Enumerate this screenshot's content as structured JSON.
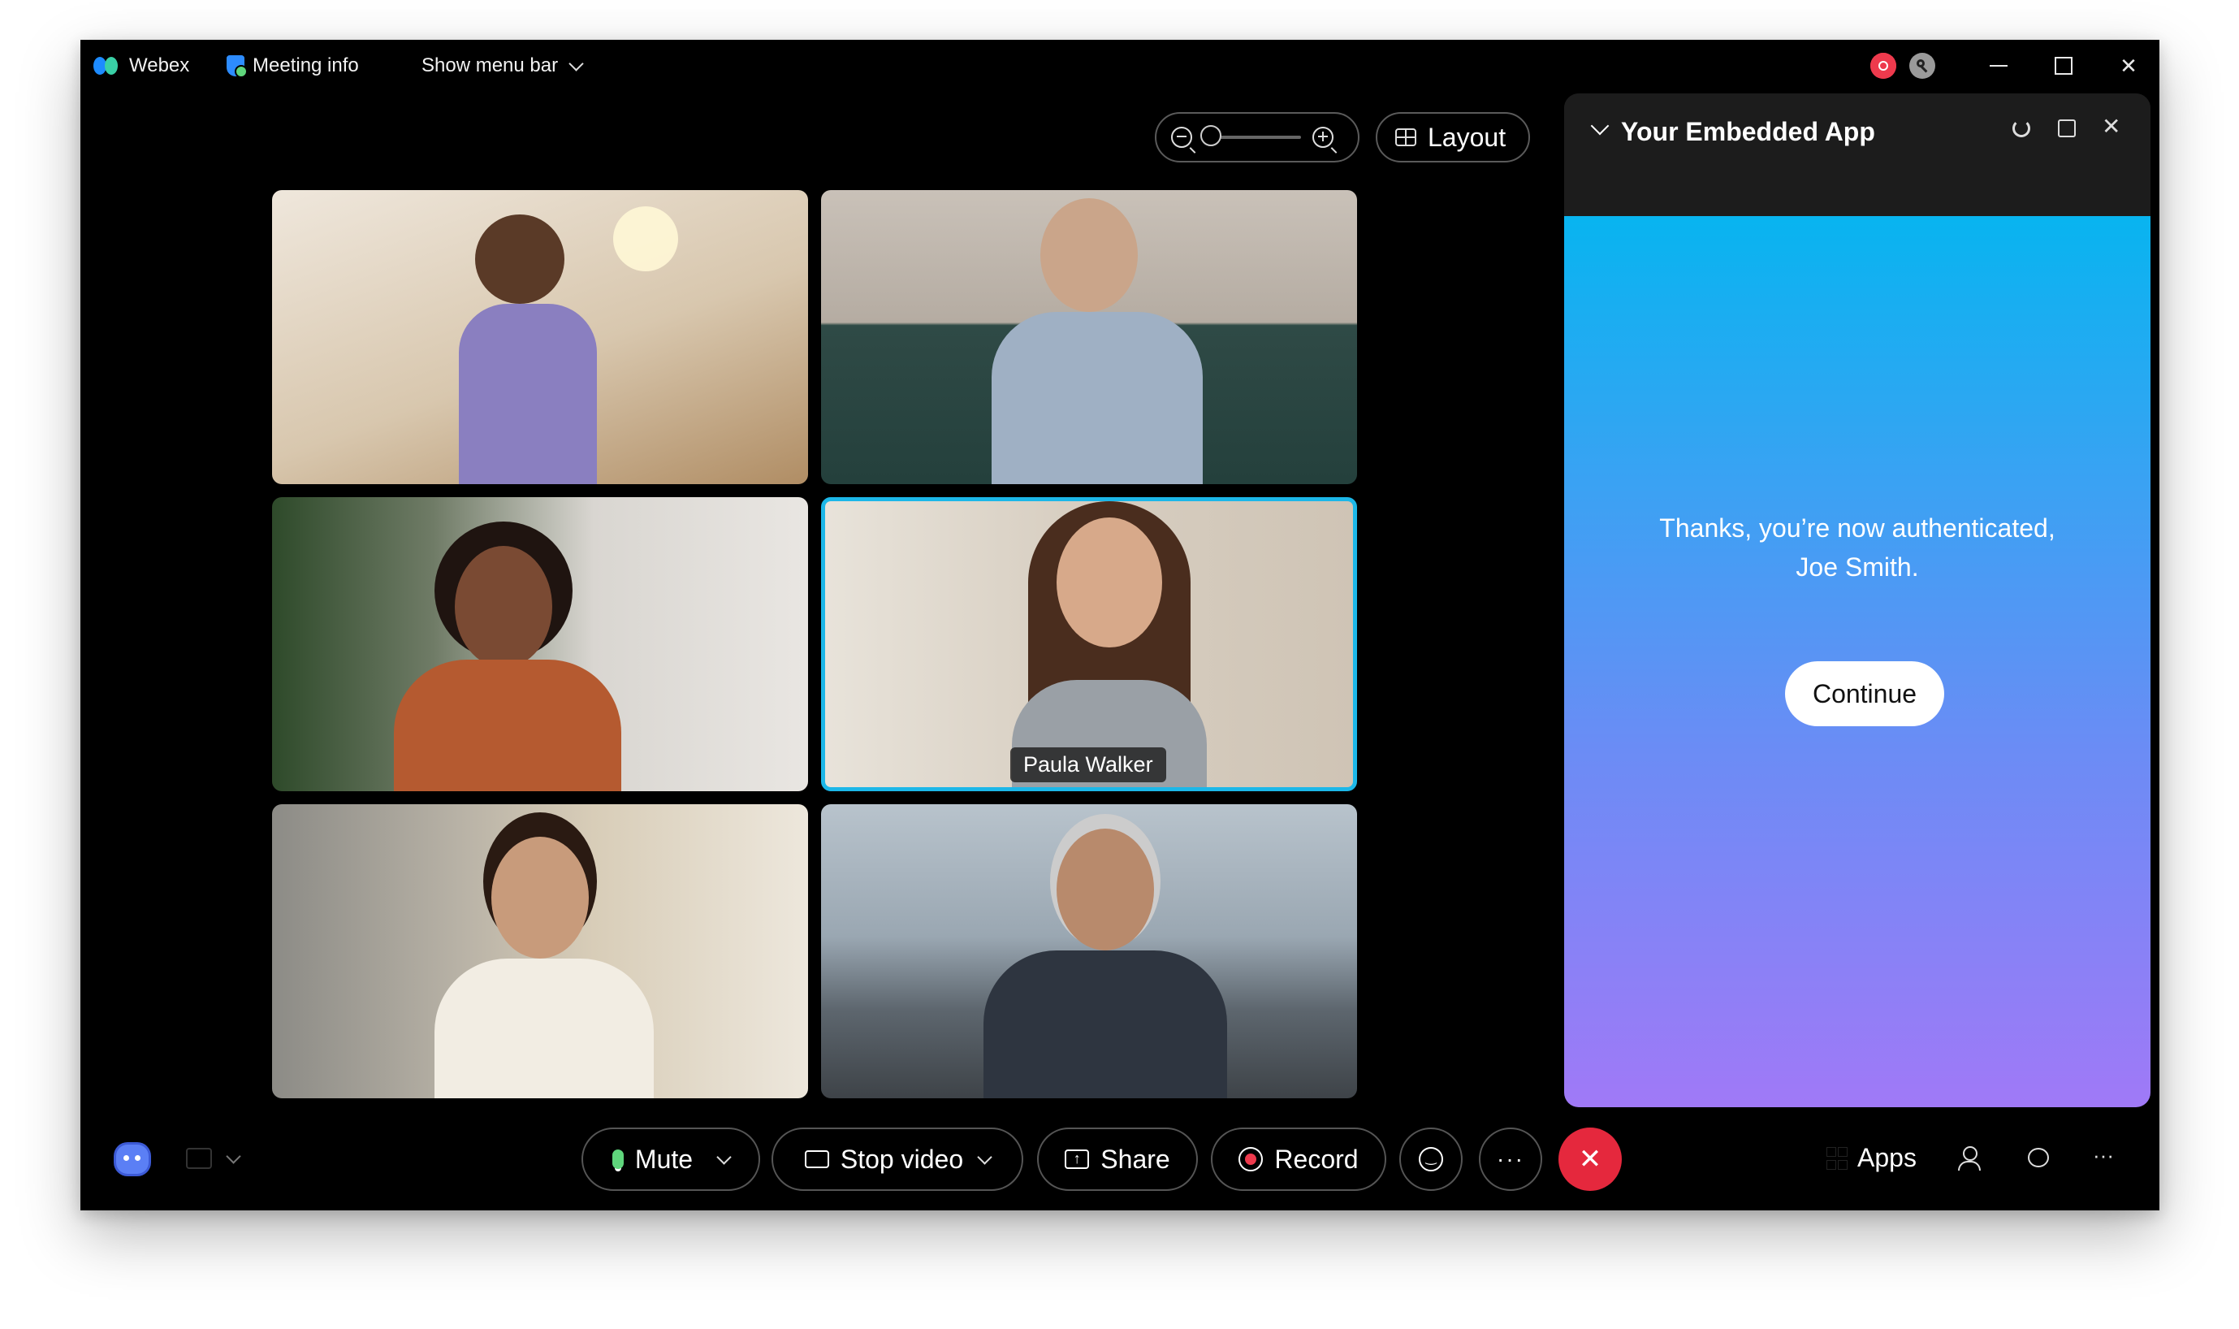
{
  "titlebar": {
    "app_name": "Webex",
    "meeting_info": "Meeting info",
    "show_menu_bar": "Show menu bar"
  },
  "layout_button": "Layout",
  "participants": [
    {
      "name": ""
    },
    {
      "name": ""
    },
    {
      "name": ""
    },
    {
      "name": "Paula Walker"
    },
    {
      "name": ""
    },
    {
      "name": ""
    }
  ],
  "embedded_app": {
    "title": "Your Embedded App",
    "message_line1": "Thanks, you’re now authenticated,",
    "message_line2": "Joe Smith.",
    "continue_label": "Continue"
  },
  "controls": {
    "mute": "Mute",
    "stop_video": "Stop video",
    "share": "Share",
    "record": "Record",
    "apps": "Apps"
  },
  "colors": {
    "active_speaker_border": "#1cb7e8",
    "end_call": "#e5283d",
    "record_dot": "#ee3a4d"
  }
}
